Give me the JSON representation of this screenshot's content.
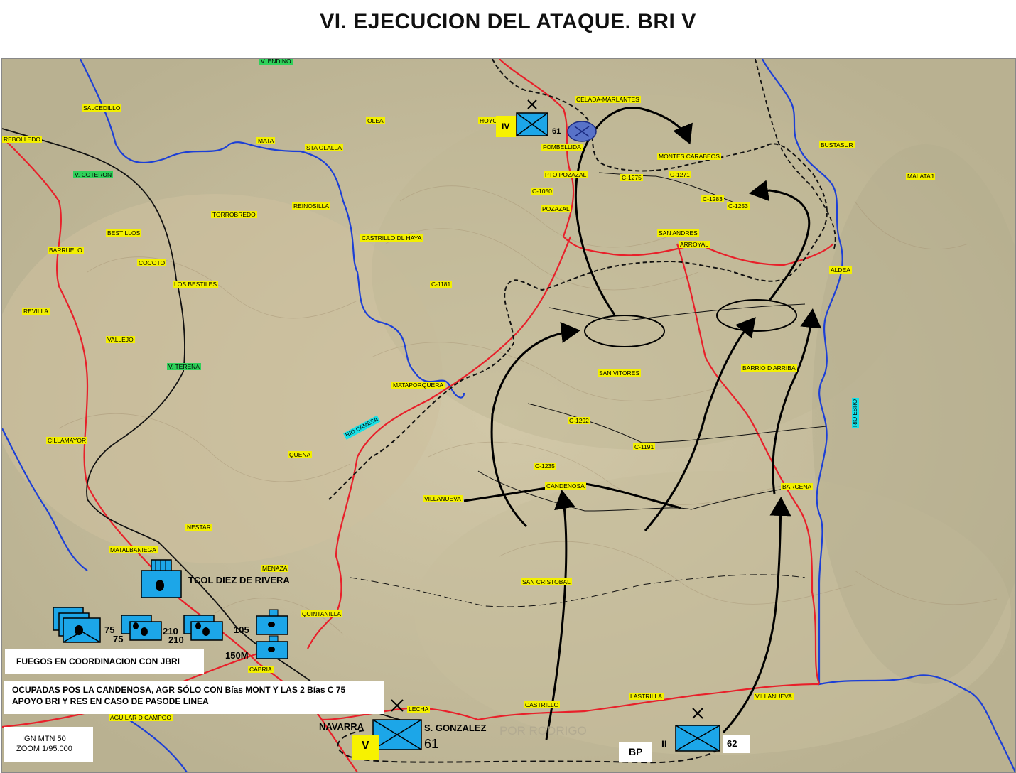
{
  "title": "VI. EJECUCION DEL ATAQUE. BRI V",
  "places": [
    {
      "id": "v-endino",
      "label": "V. ENDINO",
      "green": true
    },
    {
      "id": "salcedillo",
      "label": "SALCEDILLO"
    },
    {
      "id": "olea",
      "label": "OLEA"
    },
    {
      "id": "hoyos",
      "label": "HOYOS"
    },
    {
      "id": "celada",
      "label": "CELADA-MARLANTES"
    },
    {
      "id": "rebolledo",
      "label": "REBOLLEDO"
    },
    {
      "id": "v-coteron",
      "label": "V. COTERON",
      "green": true
    },
    {
      "id": "mata",
      "label": "MATA"
    },
    {
      "id": "sta-olalla",
      "label": "STA OLALLA"
    },
    {
      "id": "fombellida",
      "label": "FOMBELLIDA"
    },
    {
      "id": "montes-carabeos",
      "label": "MONTES CARABEOS"
    },
    {
      "id": "bustasur",
      "label": "BUSTASUR"
    },
    {
      "id": "pto-pozazal",
      "label": "PTO POZAZAL"
    },
    {
      "id": "c1275",
      "label": "C-1275"
    },
    {
      "id": "c1271",
      "label": "C-1271"
    },
    {
      "id": "malataj",
      "label": "MALATAJ"
    },
    {
      "id": "c1050",
      "label": "C-1050"
    },
    {
      "id": "c1283",
      "label": "C-1283"
    },
    {
      "id": "c1253",
      "label": "C-1253"
    },
    {
      "id": "torrobredo",
      "label": "TORROBREDO"
    },
    {
      "id": "reinosilla",
      "label": "REINOSILLA"
    },
    {
      "id": "pozazal",
      "label": "POZAZAL"
    },
    {
      "id": "bestillos",
      "label": "BESTILLOS"
    },
    {
      "id": "castrillo-haya",
      "label": "CASTRILLO DL HAYA"
    },
    {
      "id": "san-andres",
      "label": "SAN ANDRES"
    },
    {
      "id": "barruelo",
      "label": "BARRUELO"
    },
    {
      "id": "arroyal",
      "label": "ARROYAL"
    },
    {
      "id": "cocoto",
      "label": "COCOTO"
    },
    {
      "id": "aldea",
      "label": "ALDEA"
    },
    {
      "id": "los-bestiles",
      "label": "LOS BESTILES"
    },
    {
      "id": "c1181",
      "label": "C-1181"
    },
    {
      "id": "revilla",
      "label": "REVILLA"
    },
    {
      "id": "vallejo",
      "label": "VALLEJO"
    },
    {
      "id": "v-terena",
      "label": "V. TERENA",
      "green": true
    },
    {
      "id": "barrio-arriba",
      "label": "BARRIO D ARRIBA"
    },
    {
      "id": "san-vitores",
      "label": "SAN VITORES"
    },
    {
      "id": "mataporquera",
      "label": "MATAPORQUERA"
    },
    {
      "id": "c1292",
      "label": "C-1292"
    },
    {
      "id": "c1191",
      "label": "C-1191"
    },
    {
      "id": "cillamayor",
      "label": "CILLAMAYOR"
    },
    {
      "id": "quena",
      "label": "QUENA"
    },
    {
      "id": "c1235",
      "label": "C-1235"
    },
    {
      "id": "candenosa",
      "label": "CANDENOSA"
    },
    {
      "id": "villanueva-1",
      "label": "VILLANUEVA"
    },
    {
      "id": "barcena",
      "label": "BARCENA"
    },
    {
      "id": "nestar",
      "label": "NESTAR"
    },
    {
      "id": "matalbaniega",
      "label": "MATALBANIEGA"
    },
    {
      "id": "menaza",
      "label": "MENAZA"
    },
    {
      "id": "san-cristobal",
      "label": "SAN CRISTOBAL"
    },
    {
      "id": "quintanilla",
      "label": "QUINTANILLA"
    },
    {
      "id": "cabria",
      "label": "CABRIA"
    },
    {
      "id": "lastrilla",
      "label": "LASTRILLA"
    },
    {
      "id": "villanueva-2",
      "label": "VILLANUEVA"
    },
    {
      "id": "castrillo",
      "label": "CASTRILLO"
    },
    {
      "id": "lecha",
      "label": "LECHA"
    },
    {
      "id": "aguilar",
      "label": "AGUILAR D CAMPOO"
    }
  ],
  "rivers": {
    "camesa": "RIO CAMESA",
    "ebro": "RIO EBRO"
  },
  "units": {
    "iv_tag": "IV",
    "iv_number": "61",
    "v_tag": "V",
    "v_number": "61",
    "ii_tag": "II",
    "ii_number": "62",
    "navarra": "NAVARRA",
    "s_gonzalez": "S. GONZALEZ",
    "bp": "BP",
    "faded": "POR RODRIGO",
    "hq": "TCOL DIEZ DE RIVERA",
    "art_75a": "75",
    "art_75b": "75",
    "art_210a": "210",
    "art_210b": "210",
    "art_105": "105",
    "art_150": "150M"
  },
  "notes": {
    "fuegos": "FUEGOS EN COORDINACION CON JBRI",
    "ocupadas_1": "OCUPADAS POS LA CANDENOSA,  AGR SÓLO CON Bías MONT Y LAS 2 Bías C 75",
    "ocupadas_2": "APOYO BRI Y RES EN CASO DE PASODE LINEA",
    "scale_1": "IGN MTN 50",
    "scale_2": "ZOOM 1/95.000"
  },
  "colors": {
    "road": "#e8202a",
    "river": "#1c3fd6",
    "unit_fill": "#1ca6e8",
    "place_tag": "#f3f000",
    "valley_tag": "#2fd15a",
    "river_tag": "#18e0e6"
  }
}
